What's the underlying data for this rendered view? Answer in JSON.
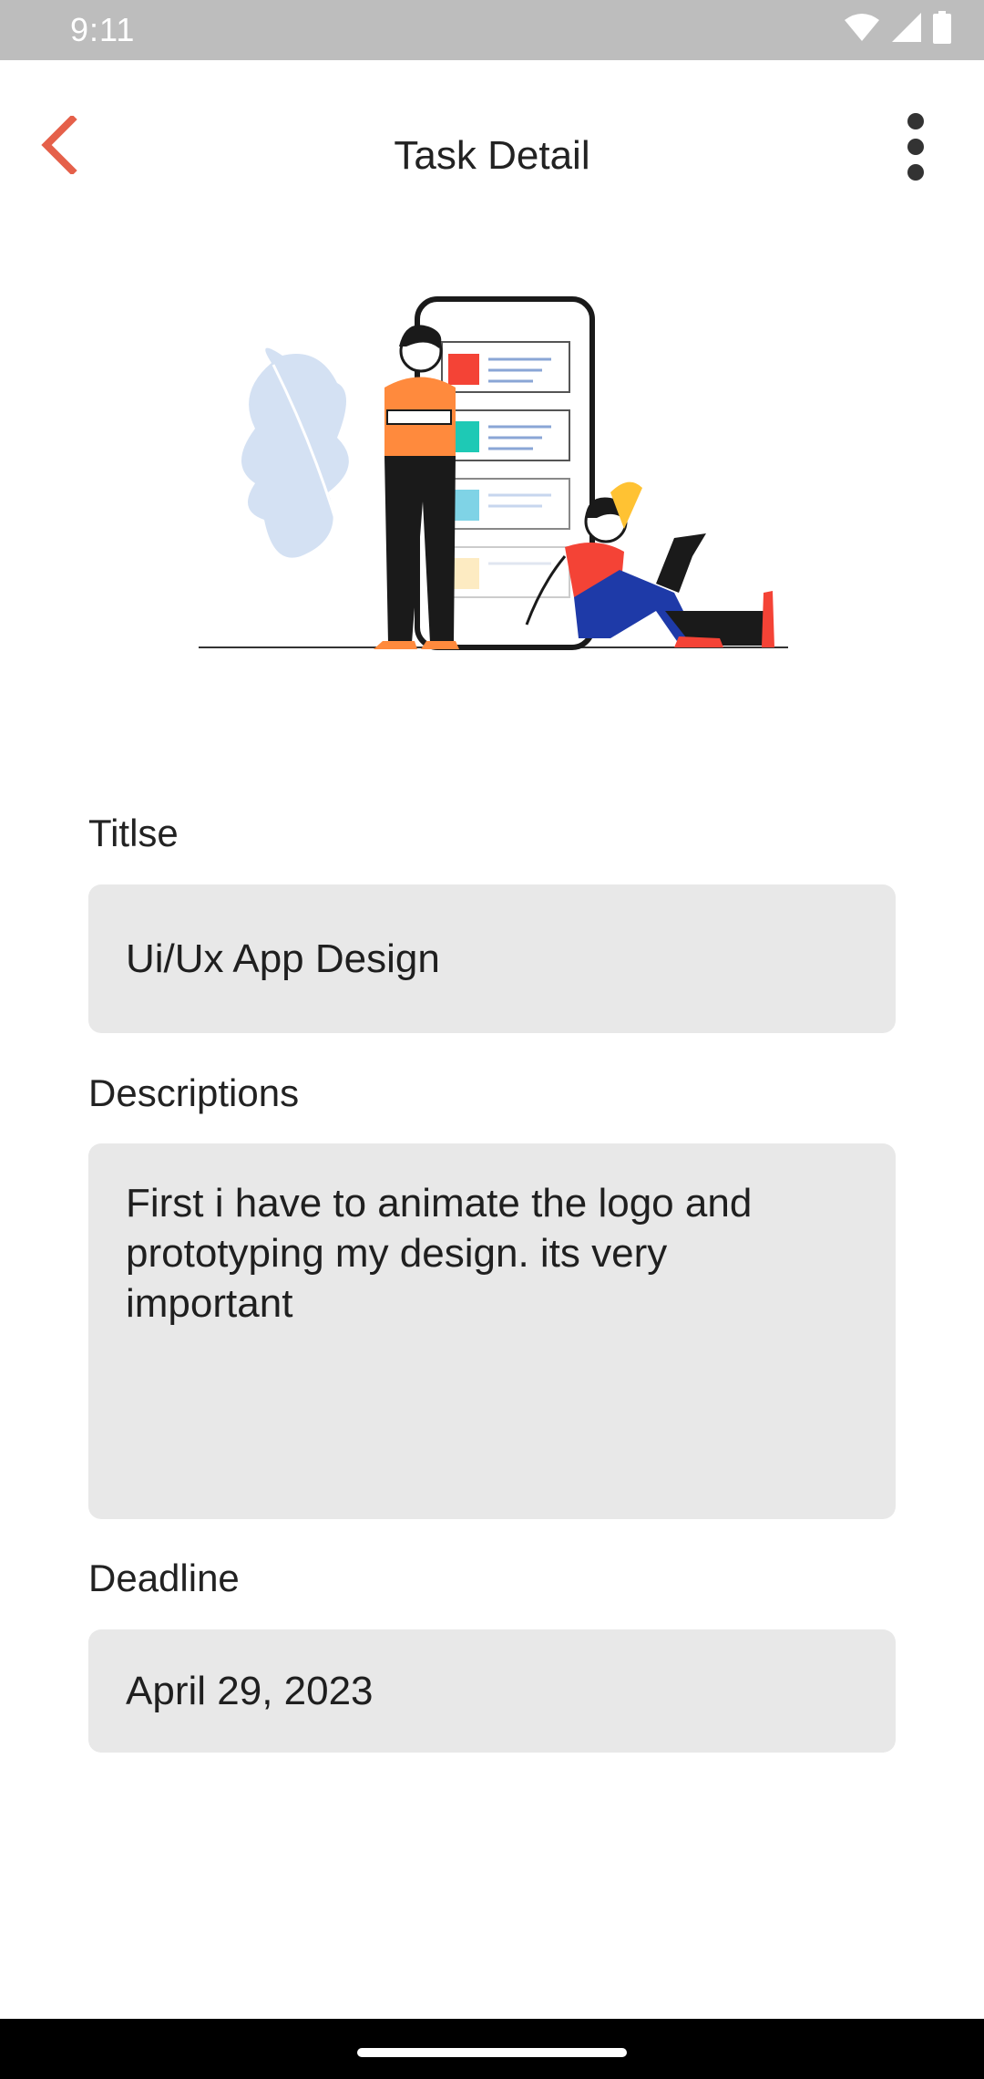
{
  "status_bar": {
    "time": "9:11",
    "icons": [
      "wifi-icon",
      "signal-icon",
      "battery-icon"
    ]
  },
  "app_bar": {
    "title": "Task Detail",
    "back_icon": "chevron-left-icon",
    "more_icon": "more-vertical-icon",
    "accent_color": "#e5604a"
  },
  "form": {
    "title_label": "Titlse",
    "title_value": "Ui/Ux App Design",
    "description_label": "Descriptions",
    "description_value": "First i have to animate the logo and\nprototyping my design. its very\nimportant",
    "deadline_label": "Deadline",
    "deadline_value": "April 29, 2023"
  }
}
